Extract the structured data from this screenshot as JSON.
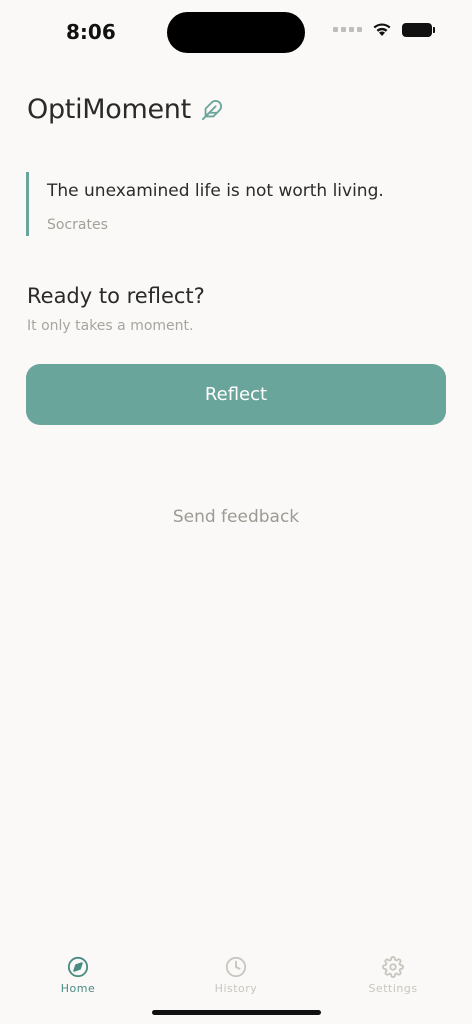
{
  "status_bar": {
    "time": "8:06"
  },
  "header": {
    "title": "OptiMoment",
    "icon": "feather-icon"
  },
  "quote": {
    "text": "The unexamined life is not worth living.",
    "author": "Socrates"
  },
  "prompt": {
    "title": "Ready to reflect?",
    "subtitle": "It only takes a moment."
  },
  "actions": {
    "reflect_label": "Reflect",
    "feedback_label": "Send feedback"
  },
  "tabs": [
    {
      "label": "Home",
      "icon": "compass-icon",
      "active": true
    },
    {
      "label": "History",
      "icon": "clock-icon",
      "active": false
    },
    {
      "label": "Settings",
      "icon": "gear-icon",
      "active": false
    }
  ],
  "colors": {
    "accent": "#6aa59c",
    "background": "#faf9f7",
    "muted_text": "#a3a09a"
  }
}
